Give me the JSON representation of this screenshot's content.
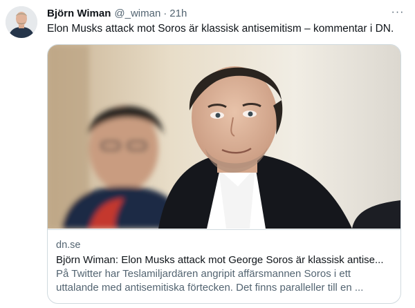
{
  "author": {
    "name": "Björn Wiman",
    "handle": "@_wiman",
    "separator": "·",
    "time": "21h"
  },
  "tweet": {
    "text": "Elon Musks attack mot Soros är klassisk antisemitism – kommentar i DN.",
    "more_icon": "more-horizontal-icon",
    "more_label": "···"
  },
  "link_card": {
    "domain": "dn.se",
    "title": "Björn Wiman: Elon Musks attack mot George Soros är klassisk antise...",
    "description_line1": "På Twitter har Teslamiljardären angripit affärsmannen Soros i ett",
    "description_line2": "uttalande med antisemitiska förtecken. Det finns paralleller till en ..."
  },
  "colors": {
    "text_primary": "#0f1419",
    "text_secondary": "#536471",
    "border": "#cfd9de"
  }
}
